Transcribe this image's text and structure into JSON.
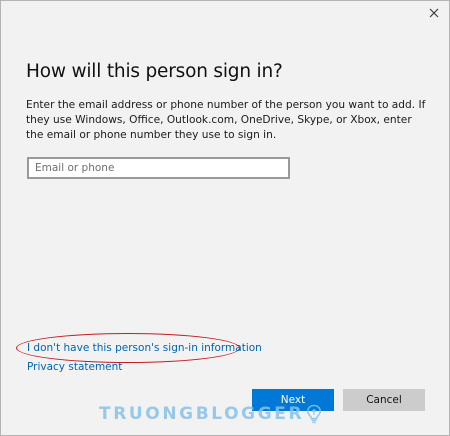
{
  "dialog": {
    "title": "How will this person sign in?",
    "description": "Enter the email address or phone number of the person you want to add. If they use Windows, Office, Outlook.com, OneDrive, Skype, or Xbox, enter the email or phone number they use to sign in.",
    "email_input": {
      "value": "",
      "placeholder": "Email or phone"
    },
    "no_signin_info_link": "I don't have this person's sign-in information",
    "privacy_link": "Privacy statement",
    "next_label": "Next",
    "cancel_label": "Cancel"
  },
  "window": {
    "close_icon": "close-icon"
  },
  "watermark": {
    "text": "TRUONGBLOGGER"
  },
  "colors": {
    "accent": "#0078d7",
    "link": "#0063b1",
    "highlight": "#c21e24",
    "background": "#f2f2f2"
  }
}
